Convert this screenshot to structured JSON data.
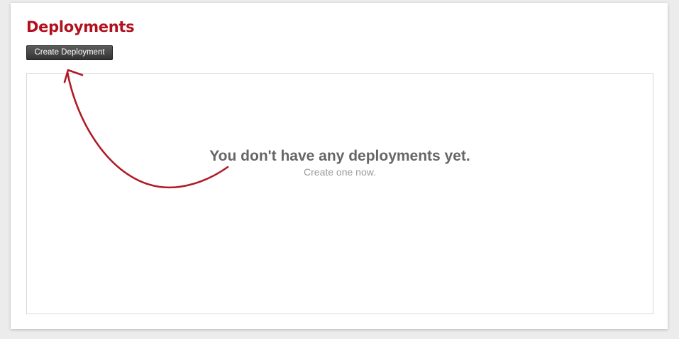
{
  "header": {
    "title": "Deployments"
  },
  "toolbar": {
    "create_label": "Create Deployment"
  },
  "empty_state": {
    "heading": "You don't have any deployments yet.",
    "subtext": "Create one now."
  },
  "colors": {
    "title": "#b3101e",
    "arrow": "#b01a26",
    "button": "#3f3f3f"
  },
  "icons": {
    "hint": "curved-arrow-icon"
  }
}
